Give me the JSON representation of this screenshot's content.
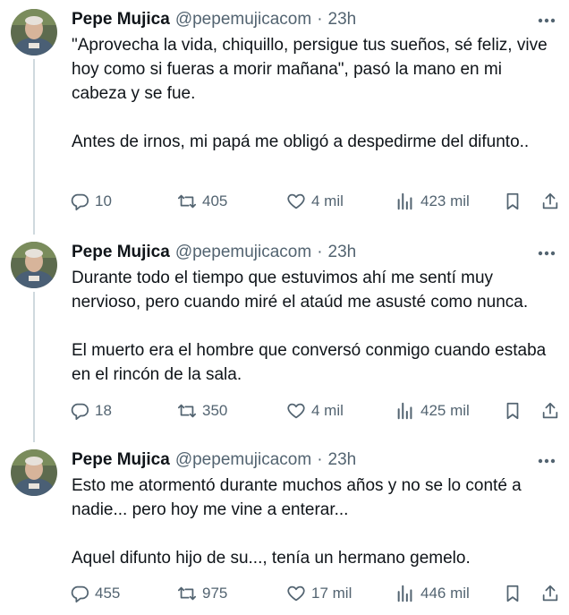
{
  "author": {
    "name": "Pepe Mujica",
    "handle": "@pepemujicacom"
  },
  "colors": {
    "text": "#0f1419",
    "secondary": "#536471",
    "thread_line": "#cfd9de"
  },
  "tweets": [
    {
      "time": "23h",
      "dot": "·",
      "paragraphs": [
        "\"Aprovecha la vida, chiquillo, persigue tus sueños, sé feliz, vive hoy como si fueras a morir mañana\", pasó la mano en mi cabeza y se fue.",
        "Antes de irnos, mi papá me obligó a despedirme del difunto.."
      ],
      "replies": "10",
      "reposts": "405",
      "likes": "4 mil",
      "views": "423 mil"
    },
    {
      "time": "23h",
      "dot": "·",
      "paragraphs": [
        "Durante todo el tiempo que estuvimos ahí me sentí muy nervioso, pero cuando miré el ataúd me asusté como nunca.",
        "El muerto era el hombre que conversó conmigo cuando estaba en el rincón de la sala."
      ],
      "replies": "18",
      "reposts": "350",
      "likes": "4 mil",
      "views": "425 mil"
    },
    {
      "time": "23h",
      "dot": "·",
      "paragraphs": [
        "Esto me atormentó durante muchos años y no se lo conté a nadie... pero hoy me vine a enterar...",
        "Aquel difunto hijo de su..., tenía un hermano gemelo."
      ],
      "replies": "455",
      "reposts": "975",
      "likes": "17 mil",
      "views": "446 mil"
    }
  ],
  "icons": {
    "reply": "reply-icon",
    "repost": "repost-icon",
    "like": "heart-icon",
    "views": "views-icon",
    "bookmark": "bookmark-icon",
    "share": "share-icon",
    "more": "more-icon"
  }
}
